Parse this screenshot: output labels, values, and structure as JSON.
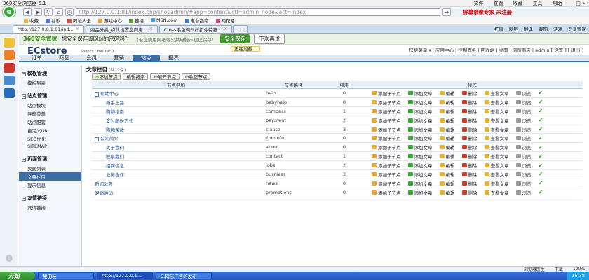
{
  "browser": {
    "title": "360安全浏览器 6.1",
    "menu": [
      "文件",
      "查看",
      "收藏",
      "工具",
      "帮助"
    ],
    "url": "http://127.0.0.1:81/index.php/shopadmin/#app=content&ctl=admin_node&act=index",
    "record_text": "屏幕录像专家 未注册"
  },
  "bookmarks": [
    "收藏",
    "谷歌",
    "网址大全",
    "游戏中心",
    "链接",
    "MSN.com",
    "电台指南",
    "网花易"
  ],
  "tabs": [
    {
      "label": "http://127.0.0.1:81/ind...",
      "active": true
    },
    {
      "label": "商品分类_点此设置您商店...",
      "active": false
    },
    {
      "label": "Cross系色调气样扣件特籍...",
      "active": false
    }
  ],
  "tab_tools": [
    "扩展",
    "网银",
    "翻译",
    "截图",
    "游戏",
    "登录管家"
  ],
  "security": {
    "brand": "360安全管家",
    "question": "想安全保存该网站的密码吗？",
    "note": "（若您使用网吧等公共电脑不建议保存）",
    "save_label": "安全保存",
    "later_label": "下次再说"
  },
  "app": {
    "name": "ECstore",
    "sub": "ShopEx CBRT INFO",
    "loading": "正在加载...",
    "toplinks": "快捷菜单 ▾ | 应用中心 | 控制面板 | 回收站 | 桌面 | 浏览商店 | admin [ 设置 ] [ 退出 ]"
  },
  "mainnav": [
    {
      "label": "订单",
      "active": false
    },
    {
      "label": "商品",
      "active": false
    },
    {
      "label": "会员",
      "active": false
    },
    {
      "label": "营销",
      "active": false
    },
    {
      "label": "站点",
      "active": true
    },
    {
      "label": "报表",
      "active": false
    }
  ],
  "leftmenu": [
    {
      "group": "模板管理",
      "items": [
        "模板列表"
      ]
    },
    {
      "group": "站点管理",
      "items": [
        "站点模块",
        "导航菜单",
        "站点配置",
        "自定义URL",
        "SEO优化",
        "SITEMAP"
      ]
    },
    {
      "group": "页面管理",
      "items": [
        "页面列表",
        "文章栏目",
        "提示信息"
      ]
    },
    {
      "group": "友情链接",
      "items": [
        "友情链接"
      ]
    }
  ],
  "leftmenu_active": "文章栏目",
  "content": {
    "title": "文章栏目",
    "count": "(共12条)",
    "toolbar": [
      "添加节点",
      "编辑排序",
      "展开节点",
      "收起节点"
    ],
    "columns": [
      "节点名称",
      "节点路径",
      "排序",
      "操作"
    ],
    "ops": [
      "添加子节点",
      "添加文章",
      "编辑",
      "删除",
      "查看文章",
      "浏览"
    ],
    "rows": [
      {
        "name": "帮助中心",
        "path": "help",
        "sort": "0",
        "level": 0,
        "parent": true
      },
      {
        "name": "新手上路",
        "path": "babyhelp",
        "sort": "0",
        "level": 1,
        "parent": false
      },
      {
        "name": "购物指南",
        "path": "compass",
        "sort": "1",
        "level": 1,
        "parent": false
      },
      {
        "name": "支付配送方式",
        "path": "payment",
        "sort": "2",
        "level": 1,
        "parent": false
      },
      {
        "name": "购物条款",
        "path": "clause",
        "sort": "3",
        "level": 1,
        "parent": false
      },
      {
        "name": "公司简介",
        "path": "cominfo",
        "sort": "0",
        "level": 0,
        "parent": true
      },
      {
        "name": "关于我们",
        "path": "about",
        "sort": "0",
        "level": 1,
        "parent": false
      },
      {
        "name": "联系我们",
        "path": "contact",
        "sort": "1",
        "level": 1,
        "parent": false
      },
      {
        "name": "招聘信息",
        "path": "jobs",
        "sort": "2",
        "level": 1,
        "parent": false
      },
      {
        "name": "业务合作",
        "path": "busniess",
        "sort": "3",
        "level": 1,
        "parent": false
      },
      {
        "name": "新闻公告",
        "path": "news",
        "sort": "0",
        "level": 0,
        "parent": false
      },
      {
        "name": "促销活动",
        "path": "promotions",
        "sort": "0",
        "level": 0,
        "parent": false
      }
    ]
  },
  "statusbar": [
    "浏览器医生",
    "下载",
    "100%"
  ],
  "taskbar": {
    "start": "开始",
    "tasks": [
      "果田装",
      "http://127.0.0.1...",
      "5.网店广告的发布"
    ],
    "clock": "16:38"
  },
  "colors": {
    "accent": "#3a6ea5",
    "green": "#3e9d2e",
    "taskbar": "#2456c4"
  }
}
